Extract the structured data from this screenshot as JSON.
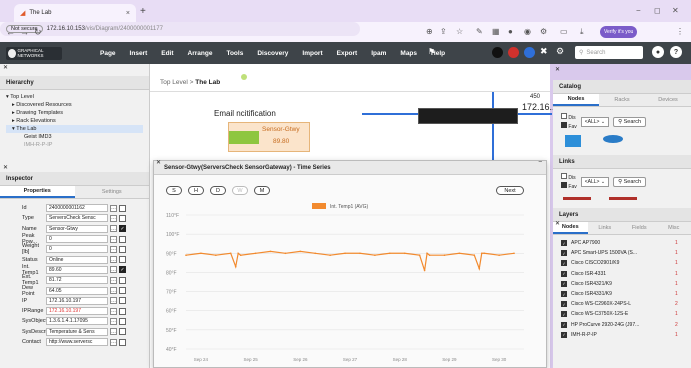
{
  "browser": {
    "tab_title": "The Lab",
    "new_tab": "+",
    "not_secure": "Not secure",
    "url_host": "172.16.10.153",
    "url_path": "/vis/Diagram/2400000001177",
    "verify": "Verify it's you"
  },
  "app": {
    "logo_text": "GRAPHICAL NETWORKS",
    "menu": [
      "Page",
      "Insert",
      "Edit",
      "Arrange",
      "Tools",
      "Discovery",
      "Import",
      "Export",
      "Ipam",
      "Maps",
      "Help"
    ],
    "search_placeholder": "Search"
  },
  "hierarchy": {
    "title": "Hierarchy",
    "items": [
      "Top Level",
      "Discovered Resources",
      "Drawing Templates",
      "Rack Elevations",
      "The Lab",
      "Geist IMD3",
      "IMH-R-P-IP"
    ]
  },
  "inspector": {
    "title": "Inspector",
    "tabs": [
      "Properties",
      "Settings"
    ],
    "rows": [
      {
        "k": "Id",
        "v": "2400000001162"
      },
      {
        "k": "Type",
        "v": "ServersCheck Sensc"
      },
      {
        "k": "Name",
        "v": "Sensor-Gtwy"
      },
      {
        "k": "Peak Pow...",
        "v": "0"
      },
      {
        "k": "Weight [lb]",
        "v": "0"
      },
      {
        "k": "Status",
        "v": "Online"
      },
      {
        "k": "Int. Temp1",
        "v": "89.60"
      },
      {
        "k": "Ext. Temp1",
        "v": "81.72"
      },
      {
        "k": "Dew Point",
        "v": "64.05"
      },
      {
        "k": "IP",
        "v": "172.16.10.197"
      },
      {
        "k": "IPRange",
        "v": "172.16.10.197"
      },
      {
        "k": "SysObjectId",
        "v": "1.3.6.1.4.1.17095"
      },
      {
        "k": "SysDescri...",
        "v": "Temperature & Sens"
      },
      {
        "k": "Contact",
        "v": "http://www.serversc"
      }
    ]
  },
  "canvas": {
    "breadcrumb_root": "Top Level",
    "breadcrumb_sep": ">",
    "breadcrumb_current": "The Lab",
    "email_label": "Email ncitification",
    "sensor_name": "Sensor-Gtwy",
    "sensor_value": "89.80",
    "device_label_1": "450",
    "device_label_2": "172.16.1"
  },
  "modal": {
    "title": "Sensor-Gtwy(ServersCheck SensorGateway) - Time Series",
    "ranges": [
      "S",
      "H",
      "D",
      "W",
      "M"
    ],
    "next": "Next",
    "legend": "Int. Temp1 (AVG)",
    "series_color": "#f28a2e"
  },
  "chart_data": {
    "type": "line",
    "title": "",
    "xlabel": "",
    "ylabel": "",
    "y_ticks": [
      "110°F",
      "100°F",
      "90°F",
      "80°F",
      "70°F",
      "60°F",
      "50°F",
      "40°F"
    ],
    "x_ticks": [
      "Sep 24",
      "Sep 25",
      "Sep 26",
      "Sep 27",
      "Sep 28",
      "Sep 29",
      "Sep 30"
    ],
    "ylim": [
      40,
      110
    ],
    "series": [
      {
        "name": "Int. Temp1 (AVG)",
        "x": [
          0,
          0.3,
          0.6,
          0.9,
          1.0,
          1.05,
          1.1,
          1.4,
          1.7,
          2.0,
          2.3,
          2.6,
          2.9,
          3.2,
          3.5,
          3.8,
          4.1,
          4.4,
          4.7,
          4.8,
          4.85,
          4.9,
          5.2,
          5.5,
          5.8,
          5.9,
          5.95,
          6.0,
          6.3,
          6.6
        ],
        "values": [
          89,
          90,
          89,
          90,
          83,
          90,
          89,
          90,
          91,
          90,
          91,
          90,
          89,
          90,
          90,
          89,
          90,
          90,
          89,
          81,
          90,
          89,
          89,
          90,
          89,
          82,
          90,
          90,
          89,
          90
        ]
      }
    ]
  },
  "catalog": {
    "title": "Catalog",
    "tabs": [
      "Nodes",
      "Racks",
      "Devices"
    ],
    "dis": "Dis",
    "fav": "Fav",
    "all": "<ALL>",
    "search": "Search"
  },
  "links": {
    "title": "Links",
    "dis": "Dis",
    "fav": "Fav",
    "all": "<ALL>",
    "search": "Search"
  },
  "layers": {
    "title": "Layers",
    "tabs": [
      "Nodes",
      "Links",
      "Fields",
      "Misc"
    ],
    "items": [
      {
        "name": "APC AP7900",
        "count": "1"
      },
      {
        "name": "APC Smart-UPS 1500VA (S...",
        "count": "1"
      },
      {
        "name": "Cisco CISCO2901/K9",
        "count": "1"
      },
      {
        "name": "Cisco ISR-4331",
        "count": "1"
      },
      {
        "name": "Cisco ISR4321/K9",
        "count": "1"
      },
      {
        "name": "Cisco ISR4331/K9",
        "count": "1"
      },
      {
        "name": "Cisco WS-C2960X-24PS-L",
        "count": "2"
      },
      {
        "name": "Cisco WS-C3750X-12S-E",
        "count": "1"
      },
      {
        "name": "HP ProCurve 2920-24G (J97...",
        "count": "2"
      },
      {
        "name": "IMH-R-P-IP",
        "count": "1"
      }
    ]
  }
}
